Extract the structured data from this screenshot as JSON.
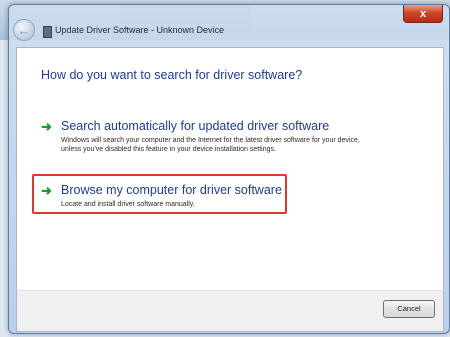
{
  "window": {
    "title": "Update Driver Software - Unknown Device",
    "close_glyph": "x"
  },
  "wizard": {
    "question": "How do you want to search for driver software?",
    "options": [
      {
        "title": "Search automatically for updated driver software",
        "description": "Windows will search your computer and the Internet for the latest driver software for your device, unless you've disabled this feature in your device installation settings.",
        "icon": "green-arrow-icon"
      },
      {
        "title": "Browse my computer for driver software",
        "description": "Locate and install driver software manually.",
        "icon": "green-arrow-icon",
        "highlighted": true
      }
    ]
  },
  "footer": {
    "cancel_label": "Cancel"
  },
  "colors": {
    "heading_blue": "#1f3d8a",
    "arrow_green": "#1d9a2c",
    "highlight_red": "#d8392a",
    "close_red": "#c7381e"
  }
}
